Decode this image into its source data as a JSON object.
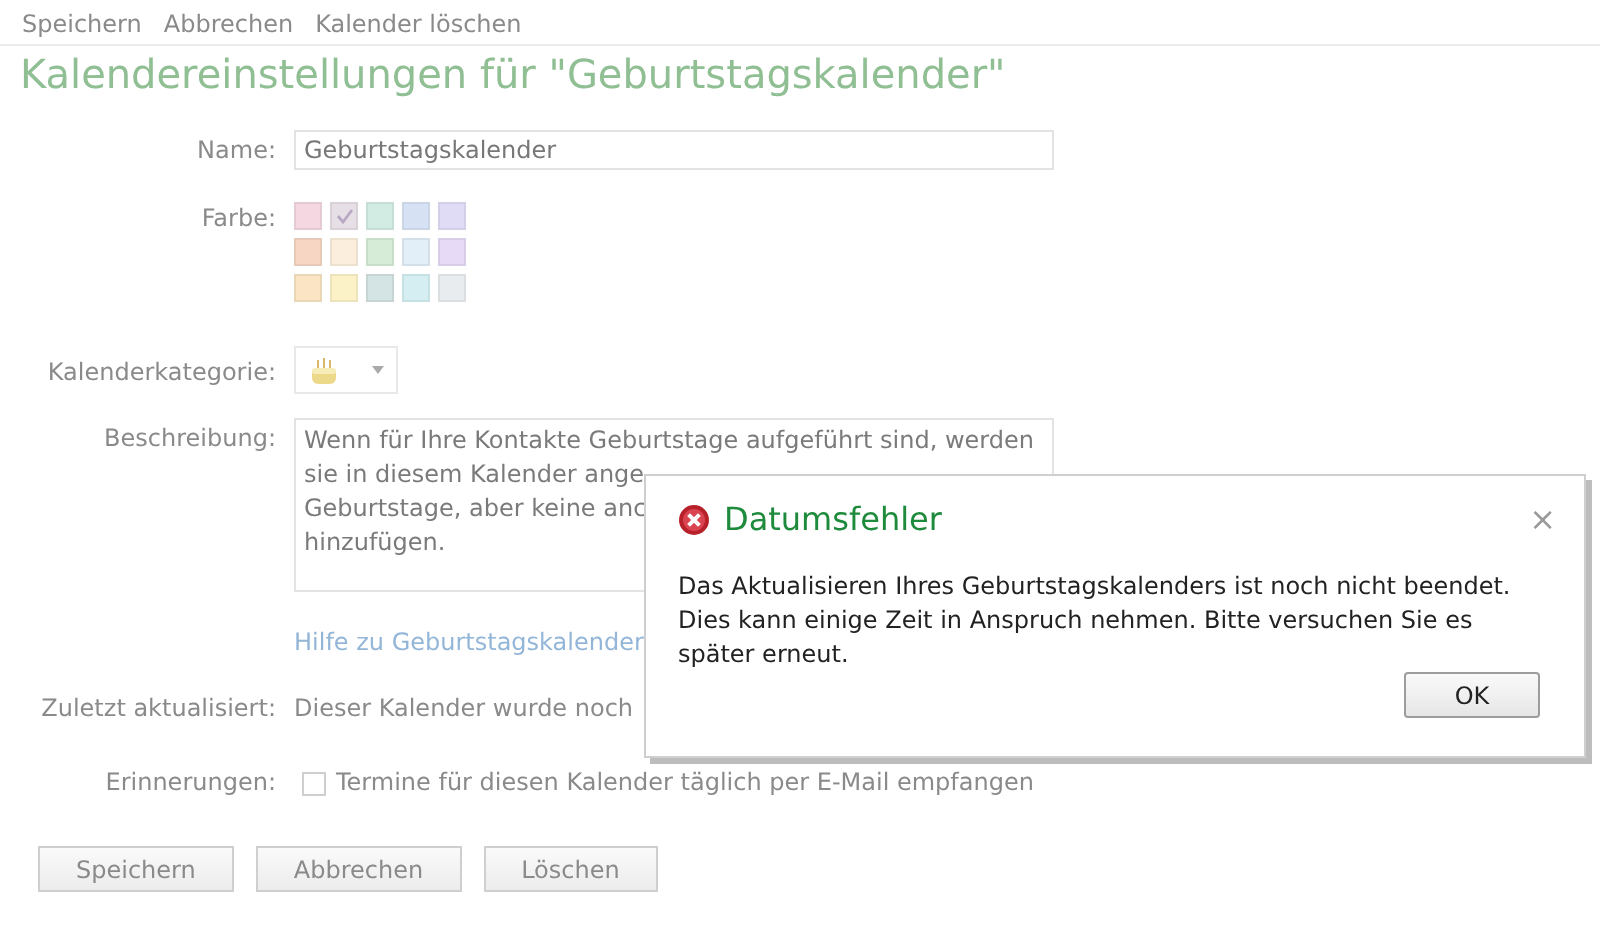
{
  "toolbar": [
    "Speichern",
    "Abbrechen",
    "Kalender löschen"
  ],
  "title": "Kalendereinstellungen für \"Geburtstagskalender\"",
  "name": {
    "label": "Name:",
    "value": "Geburtstagskalender"
  },
  "color": {
    "label": "Farbe:",
    "swatches": [
      {
        "color": "#f4d7e0",
        "selected": false
      },
      {
        "color": "#e6e0e6",
        "selected": true
      },
      {
        "color": "#d3ece3",
        "selected": false
      },
      {
        "color": "#d6e2f4",
        "selected": false
      },
      {
        "color": "#e0dcf6",
        "selected": false
      },
      {
        "color": "#f8d6c4",
        "selected": false
      },
      {
        "color": "#fbeedc",
        "selected": false
      },
      {
        "color": "#d6ecd6",
        "selected": false
      },
      {
        "color": "#e2eef8",
        "selected": false
      },
      {
        "color": "#e6daf6",
        "selected": false
      },
      {
        "color": "#fbe4c4",
        "selected": false
      },
      {
        "color": "#fcf2c8",
        "selected": false
      },
      {
        "color": "#d4e3e3",
        "selected": false
      },
      {
        "color": "#d4eef2",
        "selected": false
      },
      {
        "color": "#e9ecee",
        "selected": false
      }
    ]
  },
  "category": {
    "label": "Kalenderkategorie:"
  },
  "description": {
    "label": "Beschreibung:",
    "lines": [
      "Wenn für Ihre Kontakte Geburtstage aufgeführt sind, werden",
      "sie in diesem Kalender ange",
      "Geburtstage, aber keine anc",
      "hinzufügen."
    ]
  },
  "help_link": "Hilfe zu Geburtstagskalender",
  "last_updated": {
    "label": "Zuletzt aktualisiert:",
    "value": "Dieser Kalender wurde noch"
  },
  "reminders": {
    "label": "Erinnerungen:",
    "text": "Termine für diesen Kalender täglich per E-Mail empfangen",
    "checked": false
  },
  "buttons": [
    "Speichern",
    "Abbrechen",
    "Löschen"
  ],
  "dialog": {
    "title": "Datumsfehler",
    "close": "×",
    "message": "Das Aktualisieren Ihres Geburtstagskalenders ist noch nicht beendet. Dies kann einige Zeit in Anspruch nehmen. Bitte versuchen Sie es später erneut.",
    "button": "OK"
  }
}
